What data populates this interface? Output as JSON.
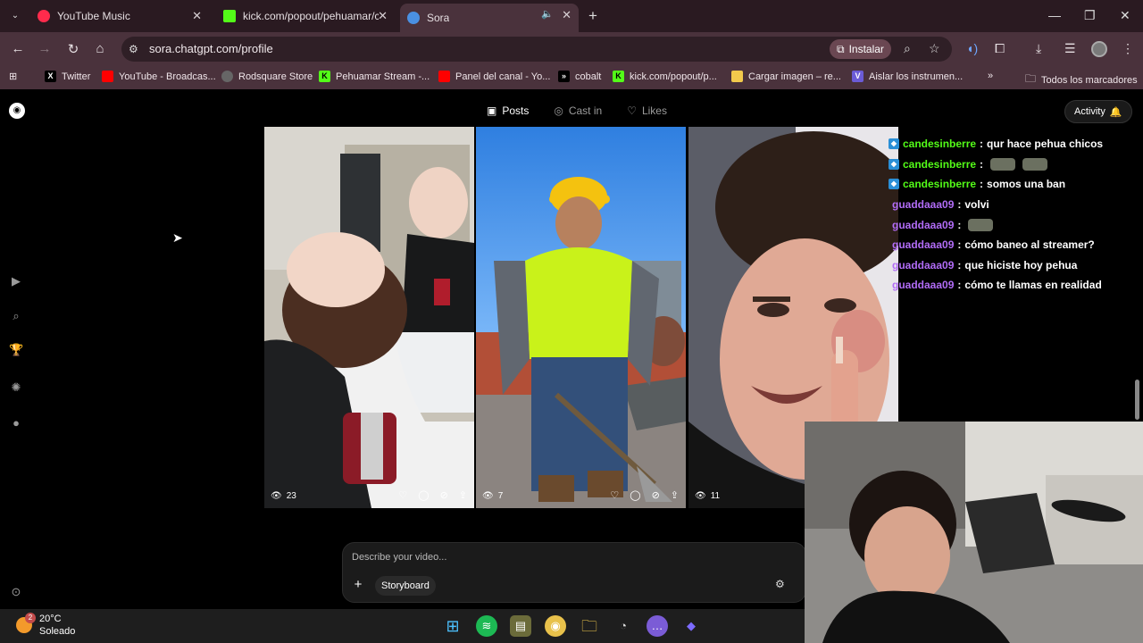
{
  "browser": {
    "tabs": [
      {
        "title": "YouTube Music",
        "color": "#ff2b4c"
      },
      {
        "title": "kick.com/popout/pehuamar/ch",
        "color": "#53fc18"
      },
      {
        "title": "Sora",
        "color": "#4a90e2"
      }
    ],
    "url": "sora.chatgpt.com/profile",
    "install_label": "Instalar"
  },
  "bookmarks": [
    {
      "label": "Twitter",
      "icon": "X",
      "color": "#000000"
    },
    {
      "label": "YouTube - Broadcas...",
      "icon": "youtube-icon",
      "color": "#ff0000"
    },
    {
      "label": "Rodsquare Store",
      "icon": "store-icon",
      "color": "#666666"
    },
    {
      "label": "Pehuamar Stream -...",
      "icon": "kick-icon",
      "color": "#53fc18"
    },
    {
      "label": "Panel del canal - Yo...",
      "icon": "youtube-icon",
      "color": "#ff0000"
    },
    {
      "label": "cobalt",
      "icon": ">>",
      "color": "#000000"
    },
    {
      "label": "kick.com/popout/p...",
      "icon": "kick-icon",
      "color": "#53fc18"
    },
    {
      "label": "Cargar imagen – re...",
      "icon": "image-icon",
      "color": "#f2c94c"
    },
    {
      "label": "Aislar los instrumen...",
      "icon": "V",
      "color": "#6b5bd6"
    }
  ],
  "bookmarks_all": "Todos los marcadores",
  "profile": {
    "tabs": [
      {
        "label": "Posts",
        "icon": "play-square-icon"
      },
      {
        "label": "Cast in",
        "icon": "person-circle-icon"
      },
      {
        "label": "Likes",
        "icon": "heart-icon"
      }
    ],
    "activity_label": "Activity"
  },
  "posts": [
    {
      "views": "23"
    },
    {
      "views": "7"
    },
    {
      "views": "11"
    }
  ],
  "chat": [
    {
      "user": "candesinberre",
      "color": "#53fc18",
      "badge": true,
      "message": "qur hace pehua chicos",
      "emotes": 0
    },
    {
      "user": "candesinberre",
      "color": "#53fc18",
      "badge": true,
      "message": "",
      "emotes": 2
    },
    {
      "user": "candesinberre",
      "color": "#53fc18",
      "badge": true,
      "message": "somos una ban",
      "emotes": 0
    },
    {
      "user": "guaddaaa09",
      "color": "#b16cf6",
      "badge": false,
      "message": "volvi",
      "emotes": 0
    },
    {
      "user": "guaddaaa09",
      "color": "#b16cf6",
      "badge": false,
      "message": "",
      "emotes": 1
    },
    {
      "user": "guaddaaa09",
      "color": "#b16cf6",
      "badge": false,
      "message": "cómo baneo al streamer?",
      "emotes": 0
    },
    {
      "user": "guaddaaa09",
      "color": "#b16cf6",
      "badge": false,
      "message": "que hiciste hoy pehua",
      "emotes": 0
    },
    {
      "user": "guaddaaa09",
      "color": "#b16cf6",
      "badge": false,
      "message": "cómo te llamas en realidad",
      "emotes": 0
    }
  ],
  "prompt": {
    "placeholder": "Describe your video...",
    "storyboard_label": "Storyboard"
  },
  "taskbar": {
    "weather_temp": "20°C",
    "weather_condition": "Soleado",
    "weather_badge": "2"
  }
}
